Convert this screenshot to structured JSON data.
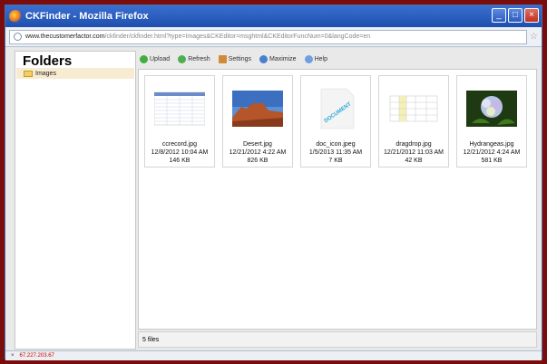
{
  "window": {
    "title": "CKFinder - Mozilla Firefox"
  },
  "urlbar": {
    "domain": "www.thecustomerfactor.com",
    "path": "/ckfinder/ckfinder.html?type=Images&CKEditor=msghtml&CKEditorFuncNum=0&langCode=en"
  },
  "sidebar": {
    "title": "Folders",
    "folders": [
      {
        "label": "Images"
      }
    ]
  },
  "toolbar": {
    "upload": "Upload",
    "refresh": "Refresh",
    "settings": "Settings",
    "maximize": "Maximize",
    "help": "Help"
  },
  "files": [
    {
      "name": "ccrecord.jpg",
      "date": "12/8/2012 10:04 AM",
      "size": "146 KB",
      "icon": "spreadsheet-thumbnail"
    },
    {
      "name": "Desert.jpg",
      "date": "12/21/2012 4:22 AM",
      "size": "826 KB",
      "icon": "desert-thumbnail"
    },
    {
      "name": "doc_icon.jpeg",
      "date": "1/5/2013 11:35 AM",
      "size": "7 KB",
      "icon": "document-thumbnail"
    },
    {
      "name": "dragdrop.jpg",
      "date": "12/21/2012 11:03 AM",
      "size": "42 KB",
      "icon": "grid-thumbnail"
    },
    {
      "name": "Hydrangeas.jpg",
      "date": "12/21/2012 4:24 AM",
      "size": "581 KB",
      "icon": "flower-thumbnail"
    }
  ],
  "status": {
    "count": "5 files"
  },
  "browser_status": {
    "ip": "67.227.203.67"
  },
  "colors": {
    "titlebar": "#1e4fae",
    "frame": "#7a0c0c",
    "folder_highlight": "#f7ebd1"
  }
}
